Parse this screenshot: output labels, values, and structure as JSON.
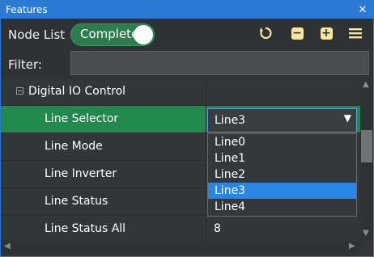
{
  "window": {
    "title": "Features"
  },
  "toolbar": {
    "node_list_label": "Node List",
    "toggle_label": "Complete",
    "icons": [
      "refresh-icon",
      "collapse-icon",
      "expand-icon",
      "menu-icon"
    ]
  },
  "filter": {
    "label": "Filter:",
    "value": "",
    "placeholder": ""
  },
  "tree": {
    "category": "Digital IO Control",
    "rows": [
      {
        "name": "Line Selector",
        "value": "Line3"
      },
      {
        "name": "Line Mode",
        "value": ""
      },
      {
        "name": "Line Inverter",
        "value": ""
      },
      {
        "name": "Line Status",
        "value": ""
      },
      {
        "name": "Line Status All",
        "value": "8"
      }
    ]
  },
  "combo": {
    "selected": "Line3",
    "options": [
      "Line0",
      "Line1",
      "Line2",
      "Line3",
      "Line4"
    ]
  },
  "colors": {
    "title_bar": "#2b7ad6",
    "selected_row": "#1f8a4c",
    "highlight_option": "#2a86e6",
    "toggle_bg": "#2b7d4e"
  }
}
